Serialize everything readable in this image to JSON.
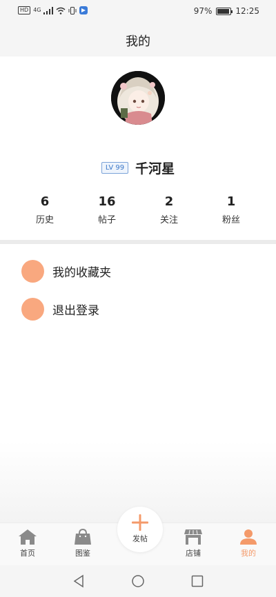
{
  "status_bar": {
    "left_icons": [
      "HD",
      "4G"
    ],
    "battery_percent": "97%",
    "battery_level": 0.97,
    "time": "12:25"
  },
  "header": {
    "title": "我的"
  },
  "profile": {
    "level": "LV 99",
    "username": "千河星"
  },
  "stats": [
    {
      "value": "6",
      "label": "历史"
    },
    {
      "value": "16",
      "label": "帖子"
    },
    {
      "value": "2",
      "label": "关注"
    },
    {
      "value": "1",
      "label": "粉丝"
    }
  ],
  "menu": [
    {
      "label": "我的收藏夹"
    },
    {
      "label": "退出登录"
    }
  ],
  "tabs": {
    "home": "首页",
    "catalog": "图鉴",
    "post": "发帖",
    "store": "店铺",
    "mine": "我的"
  },
  "colors": {
    "accent": "#f49a6a",
    "menu_dot": "#f9a87f",
    "icon_gray": "#8a8a8a"
  },
  "icons": {
    "home": "home-icon",
    "catalog": "shopping-bag-icon",
    "post": "plus-icon",
    "store": "storefront-icon",
    "mine": "person-icon"
  }
}
